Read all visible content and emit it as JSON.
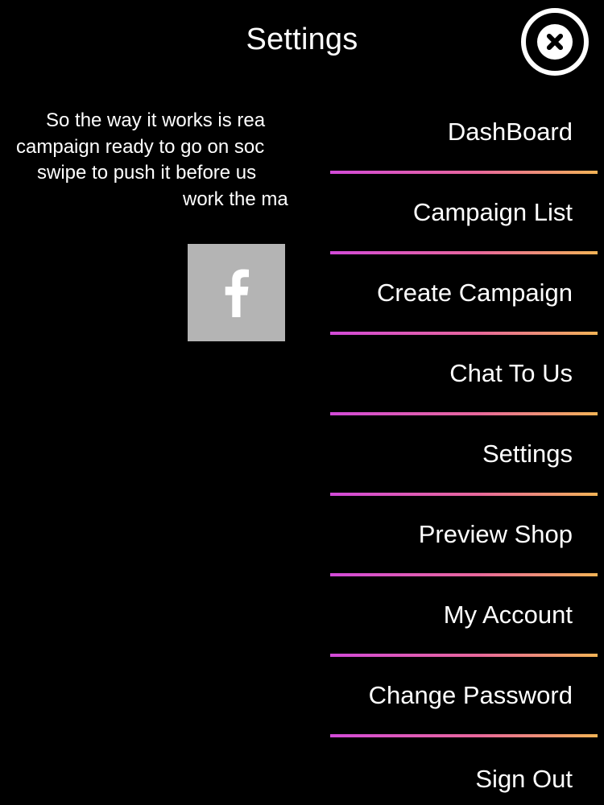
{
  "header": {
    "title": "Settings",
    "close_icon": "close-circle-icon"
  },
  "intro": {
    "lines": [
      "So the way it works is rea",
      "campaign ready to go on soc",
      "swipe to push it before us",
      "work the ma"
    ]
  },
  "social": {
    "facebook_icon": "facebook-icon",
    "tile_color": "#b4b4b4"
  },
  "menu": {
    "divider_gradient": [
      "#d24ad8",
      "#e8679c",
      "#f2b356"
    ],
    "items": [
      {
        "label": "DashBoard"
      },
      {
        "label": "Campaign List"
      },
      {
        "label": "Create Campaign"
      },
      {
        "label": "Chat To Us"
      },
      {
        "label": "Settings"
      },
      {
        "label": "Preview Shop"
      },
      {
        "label": "My Account"
      },
      {
        "label": "Change Password"
      },
      {
        "label": "Sign Out"
      }
    ]
  }
}
